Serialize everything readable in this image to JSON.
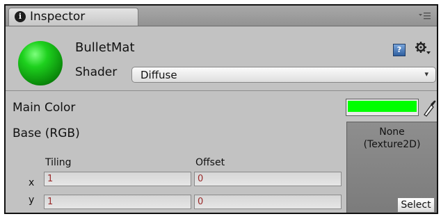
{
  "tab": {
    "title": "Inspector",
    "icon": "info-icon"
  },
  "material": {
    "name": "BulletMat",
    "shader_label": "Shader",
    "shader_value": "Diffuse",
    "preview_color": "#11c011"
  },
  "properties": {
    "main_color_label": "Main Color",
    "main_color_value": "#00ff00",
    "base_label": "Base (RGB)",
    "texture": {
      "line1": "None",
      "line2": "(Texture2D)",
      "select_label": "Select"
    },
    "tiling_label": "Tiling",
    "offset_label": "Offset",
    "x_label": "x",
    "y_label": "y",
    "tiling_x": "1",
    "tiling_y": "1",
    "offset_x": "0",
    "offset_y": "0"
  },
  "icons": {
    "help": "help-icon",
    "settings": "gear-icon",
    "menu": "panel-menu-icon",
    "eyedropper": "eyedropper-icon",
    "dropdown": "chevron-down-icon"
  }
}
